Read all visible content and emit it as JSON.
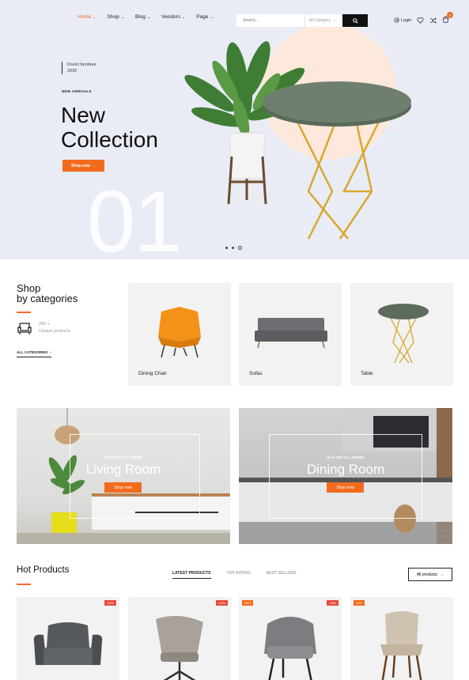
{
  "nav": {
    "items": [
      {
        "label": "Home",
        "active": true
      },
      {
        "label": "Shop",
        "active": false
      },
      {
        "label": "Blog",
        "active": false
      },
      {
        "label": "Vendors",
        "active": false
      },
      {
        "label": "Page",
        "active": false
      }
    ],
    "chevron": "⌄"
  },
  "search": {
    "placeholder": "Search...",
    "category": "All Category"
  },
  "header": {
    "login_label": "Login",
    "cart_count": "0",
    "icons": [
      "user-login-icon",
      "heart-icon",
      "shuffle-icon",
      "cart-icon"
    ]
  },
  "hero": {
    "subtitle_line1": "Dovici furniture",
    "subtitle_line2": "2020",
    "tag": "NEW ARRIVALS",
    "title_line1": "New",
    "title_line2": "Collection",
    "button_label": "Shop now",
    "slide_number": "01",
    "arrow": "→"
  },
  "categories": {
    "title_line1": "Shop",
    "title_line2": "by categories",
    "stat_count": "200 +",
    "stat_label": "Unique products",
    "all_label": "ALL CATEGORIES",
    "all_arrow": "›",
    "items": [
      {
        "label": "Dining Chair"
      },
      {
        "label": "Sofas"
      },
      {
        "label": "Table"
      }
    ]
  },
  "rooms": [
    {
      "offer": "30 % OFF ALL ORDER",
      "name": "Living Room",
      "button": "Shop now"
    },
    {
      "offer": "30 % OFF ALL ORDER",
      "name": "Dining Room",
      "button": "Shop now"
    }
  ],
  "hot": {
    "title": "Hot Products",
    "tabs": [
      {
        "label": "LATEST PRODUCTS",
        "active": true
      },
      {
        "label": "TOP RATING",
        "active": false
      },
      {
        "label": "BEST SELLERS",
        "active": false
      }
    ],
    "all_label": "All products",
    "all_arrow": "→",
    "products": [
      {
        "badge": "-20%",
        "badge_type": "sale"
      },
      {
        "badge": "-18%",
        "badge_type": "sale"
      },
      {
        "badge": "HOT",
        "badge_type": "hot",
        "badge2": "-18%"
      },
      {
        "badge": "HOT",
        "badge_type": "hot"
      }
    ]
  },
  "colors": {
    "accent": "#f26b1d",
    "hero_bg": "#e9ecf5",
    "card_bg": "#f2f2f2",
    "sale_badge": "#e94b3c"
  }
}
